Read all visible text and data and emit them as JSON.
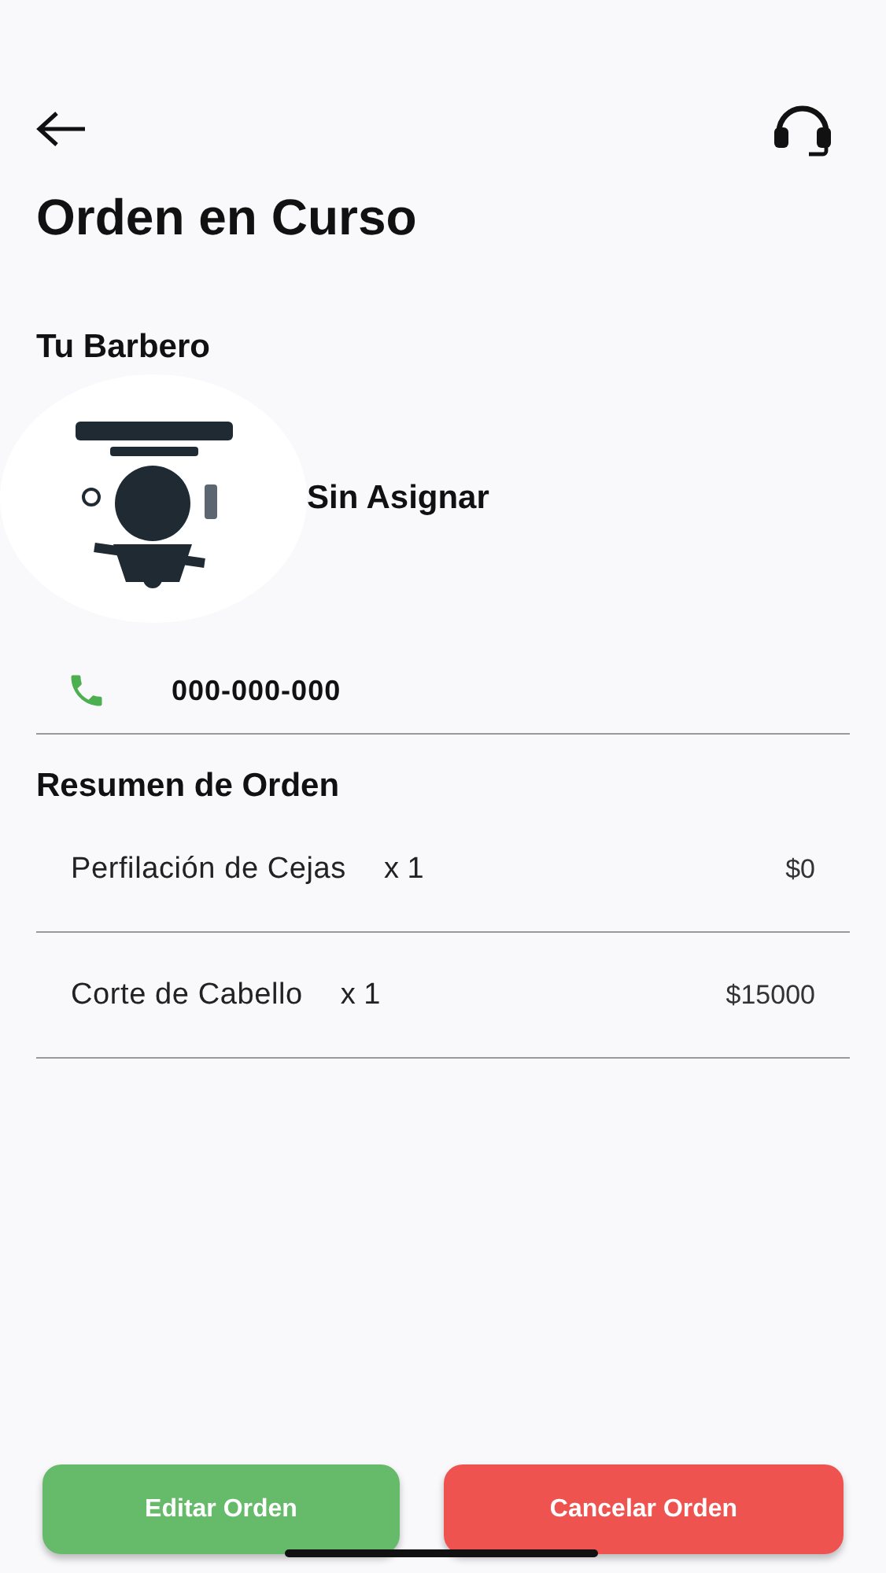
{
  "header": {
    "title": "Orden en Curso"
  },
  "barber": {
    "heading": "Tu Barbero",
    "name": "Sin Asignar",
    "phone": "000-000-000"
  },
  "summary": {
    "heading": "Resumen de Orden",
    "items": [
      {
        "name": "Perfilación de Cejas",
        "quantity": "x 1",
        "price": "$0"
      },
      {
        "name": "Corte de Cabello",
        "quantity": "x 1",
        "price": "$15000"
      }
    ]
  },
  "buttons": [
    {
      "label": "Editar Orden",
      "kind": "edit"
    },
    {
      "label": "Cancelar Orden",
      "kind": "cancel"
    }
  ]
}
